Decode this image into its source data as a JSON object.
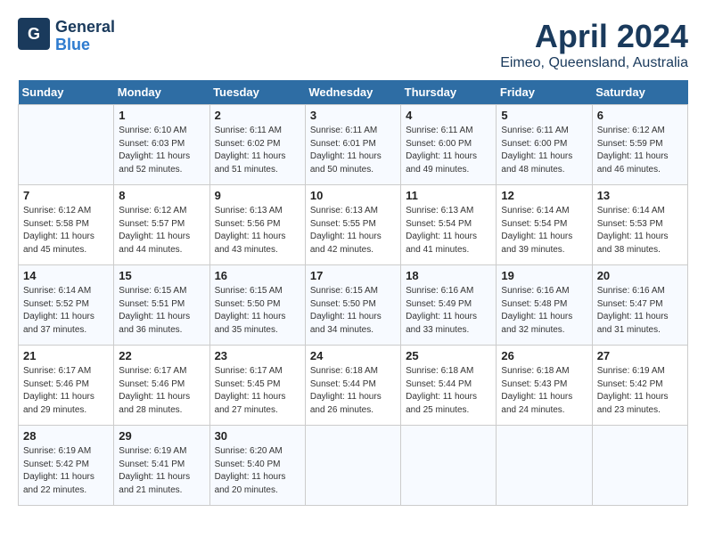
{
  "header": {
    "logo_line1": "General",
    "logo_line2": "Blue",
    "month": "April 2024",
    "location": "Eimeo, Queensland, Australia"
  },
  "days_of_week": [
    "Sunday",
    "Monday",
    "Tuesday",
    "Wednesday",
    "Thursday",
    "Friday",
    "Saturday"
  ],
  "weeks": [
    [
      {
        "day": "",
        "info": ""
      },
      {
        "day": "1",
        "info": "Sunrise: 6:10 AM\nSunset: 6:03 PM\nDaylight: 11 hours\nand 52 minutes."
      },
      {
        "day": "2",
        "info": "Sunrise: 6:11 AM\nSunset: 6:02 PM\nDaylight: 11 hours\nand 51 minutes."
      },
      {
        "day": "3",
        "info": "Sunrise: 6:11 AM\nSunset: 6:01 PM\nDaylight: 11 hours\nand 50 minutes."
      },
      {
        "day": "4",
        "info": "Sunrise: 6:11 AM\nSunset: 6:00 PM\nDaylight: 11 hours\nand 49 minutes."
      },
      {
        "day": "5",
        "info": "Sunrise: 6:11 AM\nSunset: 6:00 PM\nDaylight: 11 hours\nand 48 minutes."
      },
      {
        "day": "6",
        "info": "Sunrise: 6:12 AM\nSunset: 5:59 PM\nDaylight: 11 hours\nand 46 minutes."
      }
    ],
    [
      {
        "day": "7",
        "info": "Sunrise: 6:12 AM\nSunset: 5:58 PM\nDaylight: 11 hours\nand 45 minutes."
      },
      {
        "day": "8",
        "info": "Sunrise: 6:12 AM\nSunset: 5:57 PM\nDaylight: 11 hours\nand 44 minutes."
      },
      {
        "day": "9",
        "info": "Sunrise: 6:13 AM\nSunset: 5:56 PM\nDaylight: 11 hours\nand 43 minutes."
      },
      {
        "day": "10",
        "info": "Sunrise: 6:13 AM\nSunset: 5:55 PM\nDaylight: 11 hours\nand 42 minutes."
      },
      {
        "day": "11",
        "info": "Sunrise: 6:13 AM\nSunset: 5:54 PM\nDaylight: 11 hours\nand 41 minutes."
      },
      {
        "day": "12",
        "info": "Sunrise: 6:14 AM\nSunset: 5:54 PM\nDaylight: 11 hours\nand 39 minutes."
      },
      {
        "day": "13",
        "info": "Sunrise: 6:14 AM\nSunset: 5:53 PM\nDaylight: 11 hours\nand 38 minutes."
      }
    ],
    [
      {
        "day": "14",
        "info": "Sunrise: 6:14 AM\nSunset: 5:52 PM\nDaylight: 11 hours\nand 37 minutes."
      },
      {
        "day": "15",
        "info": "Sunrise: 6:15 AM\nSunset: 5:51 PM\nDaylight: 11 hours\nand 36 minutes."
      },
      {
        "day": "16",
        "info": "Sunrise: 6:15 AM\nSunset: 5:50 PM\nDaylight: 11 hours\nand 35 minutes."
      },
      {
        "day": "17",
        "info": "Sunrise: 6:15 AM\nSunset: 5:50 PM\nDaylight: 11 hours\nand 34 minutes."
      },
      {
        "day": "18",
        "info": "Sunrise: 6:16 AM\nSunset: 5:49 PM\nDaylight: 11 hours\nand 33 minutes."
      },
      {
        "day": "19",
        "info": "Sunrise: 6:16 AM\nSunset: 5:48 PM\nDaylight: 11 hours\nand 32 minutes."
      },
      {
        "day": "20",
        "info": "Sunrise: 6:16 AM\nSunset: 5:47 PM\nDaylight: 11 hours\nand 31 minutes."
      }
    ],
    [
      {
        "day": "21",
        "info": "Sunrise: 6:17 AM\nSunset: 5:46 PM\nDaylight: 11 hours\nand 29 minutes."
      },
      {
        "day": "22",
        "info": "Sunrise: 6:17 AM\nSunset: 5:46 PM\nDaylight: 11 hours\nand 28 minutes."
      },
      {
        "day": "23",
        "info": "Sunrise: 6:17 AM\nSunset: 5:45 PM\nDaylight: 11 hours\nand 27 minutes."
      },
      {
        "day": "24",
        "info": "Sunrise: 6:18 AM\nSunset: 5:44 PM\nDaylight: 11 hours\nand 26 minutes."
      },
      {
        "day": "25",
        "info": "Sunrise: 6:18 AM\nSunset: 5:44 PM\nDaylight: 11 hours\nand 25 minutes."
      },
      {
        "day": "26",
        "info": "Sunrise: 6:18 AM\nSunset: 5:43 PM\nDaylight: 11 hours\nand 24 minutes."
      },
      {
        "day": "27",
        "info": "Sunrise: 6:19 AM\nSunset: 5:42 PM\nDaylight: 11 hours\nand 23 minutes."
      }
    ],
    [
      {
        "day": "28",
        "info": "Sunrise: 6:19 AM\nSunset: 5:42 PM\nDaylight: 11 hours\nand 22 minutes."
      },
      {
        "day": "29",
        "info": "Sunrise: 6:19 AM\nSunset: 5:41 PM\nDaylight: 11 hours\nand 21 minutes."
      },
      {
        "day": "30",
        "info": "Sunrise: 6:20 AM\nSunset: 5:40 PM\nDaylight: 11 hours\nand 20 minutes."
      },
      {
        "day": "",
        "info": ""
      },
      {
        "day": "",
        "info": ""
      },
      {
        "day": "",
        "info": ""
      },
      {
        "day": "",
        "info": ""
      }
    ]
  ]
}
